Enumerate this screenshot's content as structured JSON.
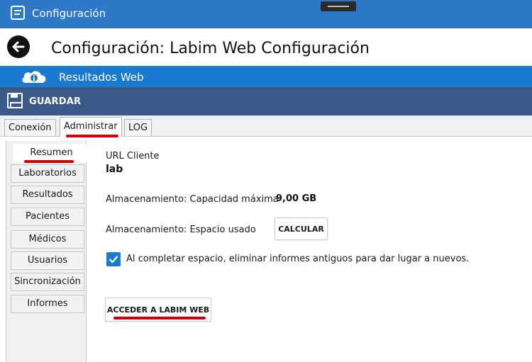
{
  "window": {
    "title": "Configuración",
    "app_icon": "app-window-icon",
    "drag_handle_icon": "drag-handle-icon"
  },
  "header": {
    "back_icon": "back-arrow-icon",
    "title": "Configuración: Labim Web Configuración"
  },
  "section": {
    "icon": "cloud-icon",
    "title": "Resultados Web",
    "color": "#1a7ad0"
  },
  "toolbar": {
    "save_icon": "floppy-disk-icon",
    "save_label": "GUARDAR",
    "color": "#3b5a8a"
  },
  "tabs": [
    {
      "label": "Conexión",
      "active": false
    },
    {
      "label": "Administrar",
      "active": true
    },
    {
      "label": "LOG",
      "active": false
    }
  ],
  "sidebar": {
    "items": [
      {
        "label": "Resumen",
        "active": true
      },
      {
        "label": "Laboratorios",
        "active": false
      },
      {
        "label": "Resultados",
        "active": false
      },
      {
        "label": "Pacientes",
        "active": false
      },
      {
        "label": "Médicos",
        "active": false
      },
      {
        "label": "Usuarios",
        "active": false
      },
      {
        "label": "Sincronización",
        "active": false
      },
      {
        "label": "Informes",
        "active": false
      }
    ]
  },
  "main": {
    "url_label": "URL Cliente",
    "url_value": "lab",
    "capacity_label": "Almacenamiento: Capacidad máxima",
    "capacity_value": "9,00 GB",
    "used_label": "Almacenamiento: Espacio usado",
    "calculate_label": "CALCULAR",
    "auto_delete_checked": true,
    "auto_delete_label": "Al completar espacio, eliminar informes antiguos para dar lugar a nuevos.",
    "access_label": "ACCEDER A LABIM WEB"
  },
  "highlight_color": "#d40000"
}
